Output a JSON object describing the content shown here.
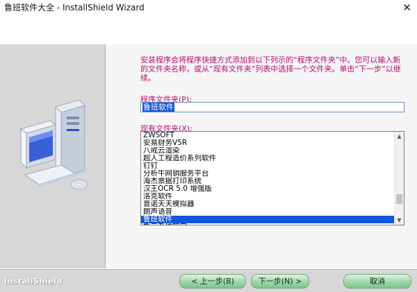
{
  "window": {
    "title": "鲁班软件大全 - InstallShield Wizard",
    "close_glyph": "✕"
  },
  "content": {
    "description": "安装程序会将程序快捷方式添加到以下列示的“程序文件夹”中。您可以输入新的文件夹名称，或从“现有文件夹”列表中选择一个文件夹。单击“下一步”以继续。",
    "program_folder_label": "程序文件夹(P):",
    "program_folder_value": "鲁班软件",
    "existing_folders_label": "现有文件夹(X):",
    "existing_folders": [
      "ZWSOFT",
      "安易财务V5R",
      "八戒云渲染",
      "超人工程造价系列软件",
      "钉钉",
      "分析牛网销服务平台",
      "海杰票据打印系统",
      "汉王OCR 5.0 增强版",
      "洛克软件",
      "普诺天天模拟器",
      "朗声语音",
      "鲁班软件",
      "鲁云系统管家"
    ],
    "selected_index": 11
  },
  "footer": {
    "brand": "InstallShield",
    "back_label": "< 上一步(B)",
    "next_label": "下一步(N) >",
    "cancel_label": "取消"
  },
  "colors": {
    "accent_text": "#b4116b",
    "selection": "#1256d9",
    "button_green": "#9fd6a9"
  }
}
